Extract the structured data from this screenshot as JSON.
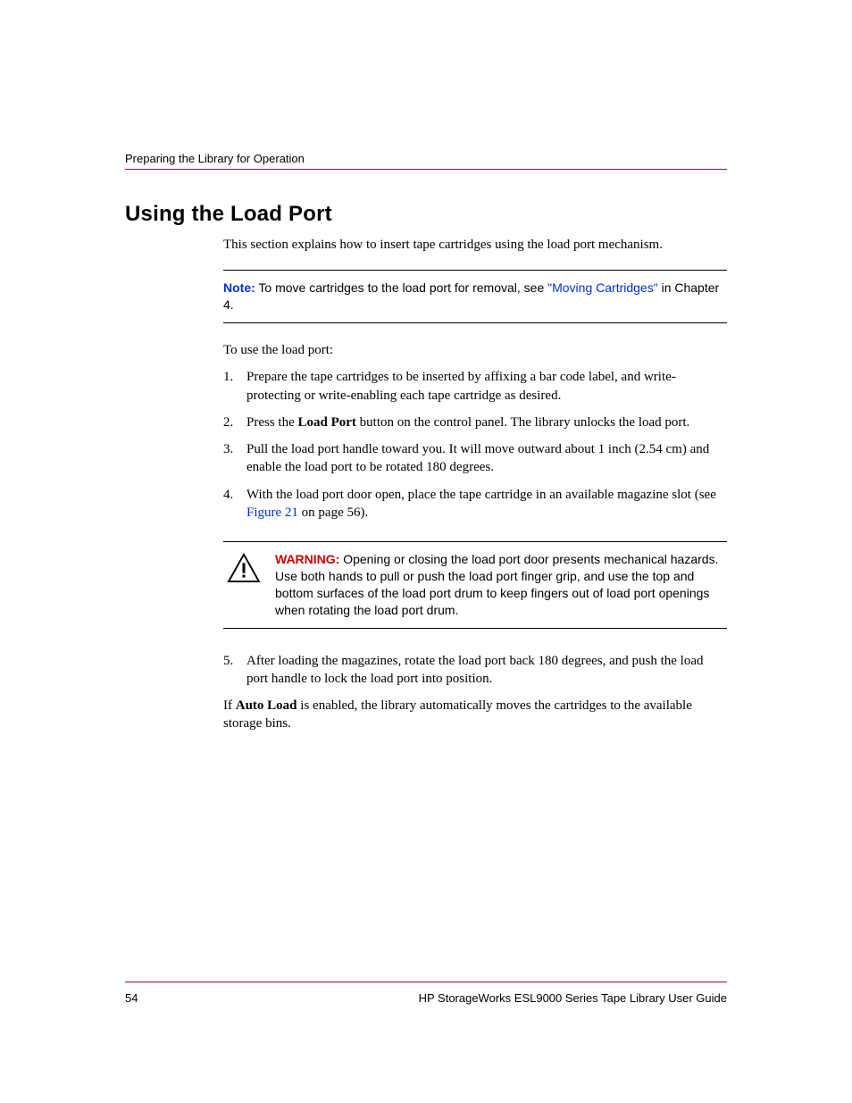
{
  "header": {
    "running": "Preparing the Library for Operation"
  },
  "section": {
    "heading": "Using the Load Port",
    "intro": "This section explains how to insert tape cartridges using the load port mechanism."
  },
  "note": {
    "label": "Note:",
    "before_link": "  To move cartridges to the load port for removal, see ",
    "link": "\"Moving Cartridges\"",
    "after_link": " in Chapter 4."
  },
  "lead_in": "To use the load port:",
  "steps": {
    "s1": {
      "num": "1.",
      "text": "Prepare the tape cartridges to be inserted by affixing a bar code label, and write-protecting or write-enabling each tape cartridge as desired."
    },
    "s2": {
      "num": "2.",
      "before_bold": "Press the ",
      "bold": "Load Port",
      "after_bold": " button on the control panel. The library unlocks the load port."
    },
    "s3": {
      "num": "3.",
      "text": "Pull the load port handle toward you. It will move outward about 1 inch (2.54 cm) and enable the load port to be rotated 180 degrees."
    },
    "s4": {
      "num": "4.",
      "before_link": "With the load port door open, place the tape cartridge in an available magazine slot (see ",
      "link": "Figure 21",
      "after_link": " on page 56)."
    },
    "s5": {
      "num": "5.",
      "text": "After loading the magazines, rotate the load port back 180 degrees, and push the load port handle to lock the load port into position."
    }
  },
  "warning": {
    "label": "WARNING:",
    "text": "  Opening or closing the load port door presents mechanical hazards. Use both hands to pull or push the load port finger grip, and use the top and bottom surfaces of the load port drum to keep fingers out of load port openings when rotating the load port drum."
  },
  "closing": {
    "before_bold": "If ",
    "bold": "Auto Load",
    "after_bold": " is enabled, the library automatically moves the cartridges to the available storage bins."
  },
  "footer": {
    "page": "54",
    "title": "HP StorageWorks ESL9000 Series Tape Library User Guide"
  }
}
